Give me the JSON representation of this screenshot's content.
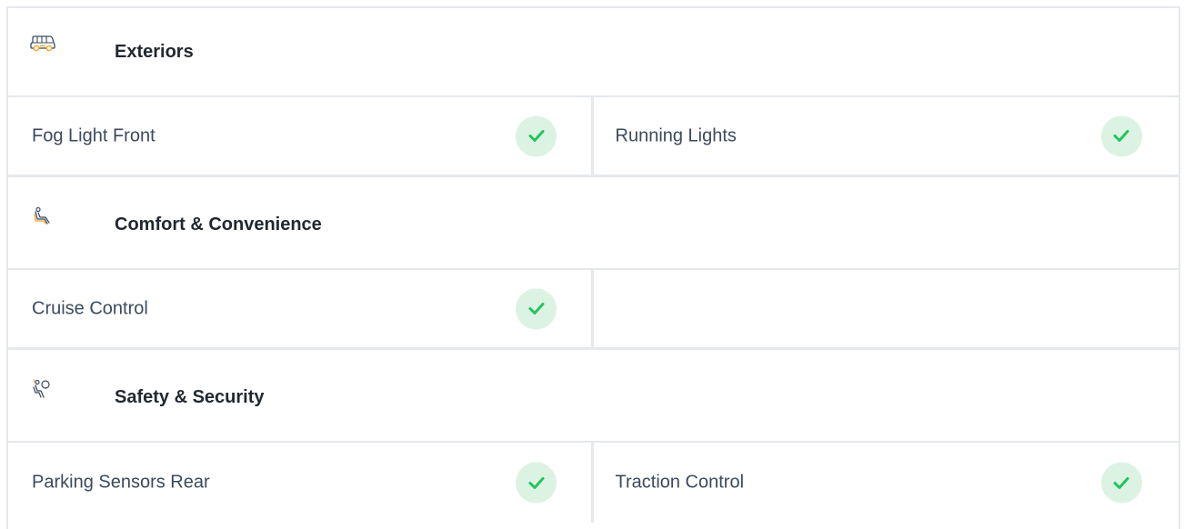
{
  "sections": [
    {
      "title": "Exteriors",
      "icon": "car-icon",
      "items": [
        {
          "label": "Fog Light Front",
          "checked": true
        },
        {
          "label": "Running Lights",
          "checked": true
        }
      ]
    },
    {
      "title": "Comfort & Convenience",
      "icon": "seat-icon",
      "items": [
        {
          "label": "Cruise Control",
          "checked": true
        },
        {
          "label": "",
          "checked": false
        }
      ]
    },
    {
      "title": "Safety & Security",
      "icon": "airbag-icon",
      "items": [
        {
          "label": "Parking Sensors Rear",
          "checked": true
        },
        {
          "label": "Traction Control",
          "checked": true
        }
      ]
    }
  ],
  "colors": {
    "check_bg": "#dcf3e4",
    "check_mark": "#22c55e",
    "icon_accent": "#f5a623",
    "border": "#e5e8ec",
    "title_text": "#222831",
    "item_text": "#3b4a5e"
  }
}
